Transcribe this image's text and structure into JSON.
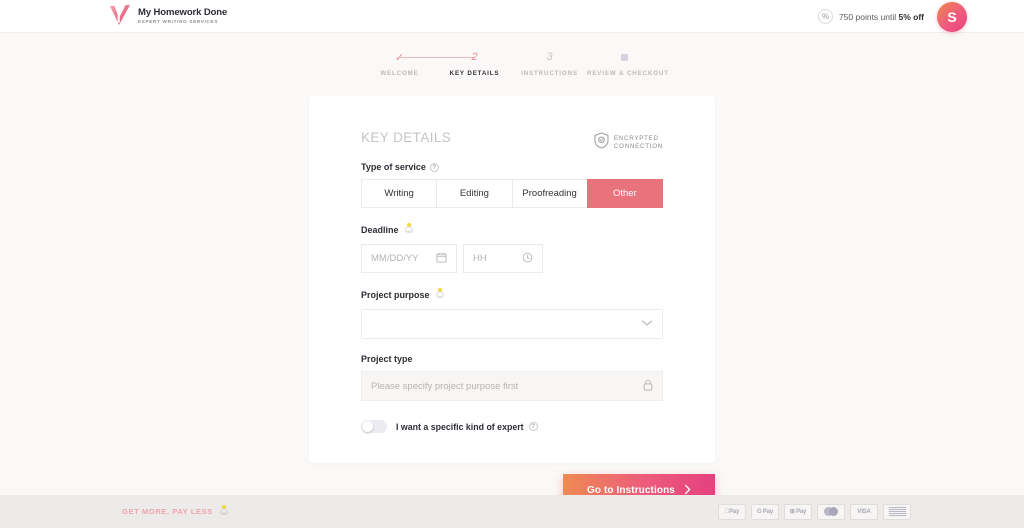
{
  "header": {
    "logo": {
      "title": "My Homework Done",
      "subtitle": "EXPERT WRITING SERVICES",
      "icon": "checkmark-heart-logo"
    },
    "points_icon": "percent-icon",
    "points_prefix": "750 points until ",
    "points_highlight": "5% off",
    "avatar_initial": "S"
  },
  "steps": [
    {
      "mark": "✓",
      "label": "WELCOME",
      "state": "done"
    },
    {
      "mark": "2",
      "label": "KEY DETAILS",
      "state": "current"
    },
    {
      "mark": "3",
      "label": "INSTRUCTIONS",
      "state": "pending"
    },
    {
      "mark": "",
      "label": "REVIEW & CHECKOUT",
      "state": "pending"
    }
  ],
  "card": {
    "title": "KEY DETAILS",
    "encrypted": {
      "icon": "shield-check-icon",
      "line1": "ENCRYPTED",
      "line2": "CONNECTION"
    },
    "type_of_service": {
      "label": "Type of service",
      "help_icon": "question-mark-icon",
      "options": [
        "Writing",
        "Editing",
        "Proofreading",
        "Other"
      ],
      "selected": "Other",
      "selected_color": "#e8737d"
    },
    "deadline": {
      "label": "Deadline",
      "tip_icon": "lightbulb-tip-icon",
      "date_placeholder": "MM/DD/YY",
      "date_value": "",
      "date_icon": "calendar-icon",
      "time_placeholder": "HH",
      "time_value": "",
      "time_icon": "clock-icon"
    },
    "project_purpose": {
      "label": "Project purpose",
      "tip_icon": "lightbulb-tip-icon",
      "value": "",
      "placeholder": "",
      "chevron_icon": "chevron-down-icon"
    },
    "project_type": {
      "label": "Project type",
      "placeholder": "Please specify project purpose first",
      "value": "",
      "lock_icon": "lock-icon",
      "disabled": true
    },
    "expert_toggle": {
      "label": "I want a specific kind of expert",
      "help_icon": "question-mark-icon",
      "state": "off"
    }
  },
  "cta": {
    "label": "Go to Instructions",
    "icon": "chevron-right-icon"
  },
  "footer": {
    "promo": "GET MORE, PAY LESS",
    "promo_icon": "lightbulb-tip-icon",
    "promo_color": "#efa3ad",
    "payments": [
      {
        "name": "apple-pay",
        "label": "Pay",
        "glyph": ""
      },
      {
        "name": "google-pay",
        "label": "Pay",
        "glyph": "G"
      },
      {
        "name": "microsoft-pay",
        "label": "Pay",
        "glyph": "⊞"
      },
      {
        "name": "mastercard",
        "label": "",
        "glyph": ""
      },
      {
        "name": "visa",
        "label": "VISA",
        "glyph": ""
      },
      {
        "name": "amex",
        "label": "",
        "glyph": ""
      }
    ]
  }
}
